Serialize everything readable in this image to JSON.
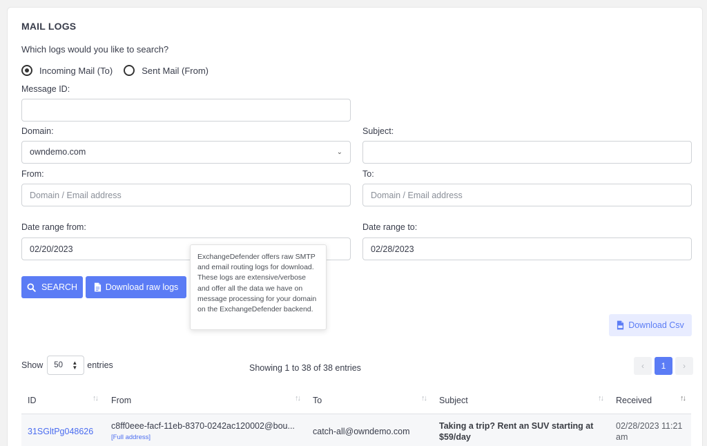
{
  "header": {
    "title": "MAIL LOGS",
    "question": "Which logs would you like to search?"
  },
  "radios": [
    {
      "label": "Incoming Mail (To)",
      "checked": true
    },
    {
      "label": "Sent Mail (From)",
      "checked": false
    }
  ],
  "form": {
    "message_id_label": "Message ID:",
    "message_id_value": "",
    "domain_label": "Domain:",
    "domain_value": "owndemo.com",
    "subject_label": "Subject:",
    "subject_value": "",
    "from_label": "From:",
    "from_placeholder": "Domain / Email address",
    "to_label": "To:",
    "to_placeholder": "Domain / Email address",
    "date_from_label": "Date range from:",
    "date_from_value": "02/20/2023",
    "date_to_label": "Date range to:",
    "date_to_value": "02/28/2023"
  },
  "buttons": {
    "search": "SEARCH",
    "download_raw": "Download raw logs",
    "download_csv": "Download Csv"
  },
  "tooltip": {
    "text": "ExchangeDefender offers raw SMTP and email routing logs for download. These logs are extensive/verbose and offer all the data we have on message processing for your domain on the ExchangeDefender backend."
  },
  "table_controls": {
    "show": "Show",
    "page_size": "50",
    "entries": "entries",
    "showing": "Showing 1 to 38 of 38 entries",
    "current_page": "1"
  },
  "table": {
    "columns": [
      "ID",
      "From",
      "To",
      "Subject",
      "Received"
    ],
    "rows": [
      {
        "id": "31SGltPg048626",
        "from": "c8ff0eee-facf-11eb-8370-0242ac120002@bou...",
        "from_link": "[Full address]",
        "to": "catch-all@owndemo.com",
        "subject_line1": "Taking a trip? Rent an SUV starting at",
        "subject_line2": "$59/day",
        "received_line1": "02/28/2023 11:21",
        "received_line2": "am"
      }
    ]
  },
  "colors": {
    "accent": "#5b7cf5",
    "accent_light": "#e8ecff",
    "link": "#4a6cf0"
  }
}
